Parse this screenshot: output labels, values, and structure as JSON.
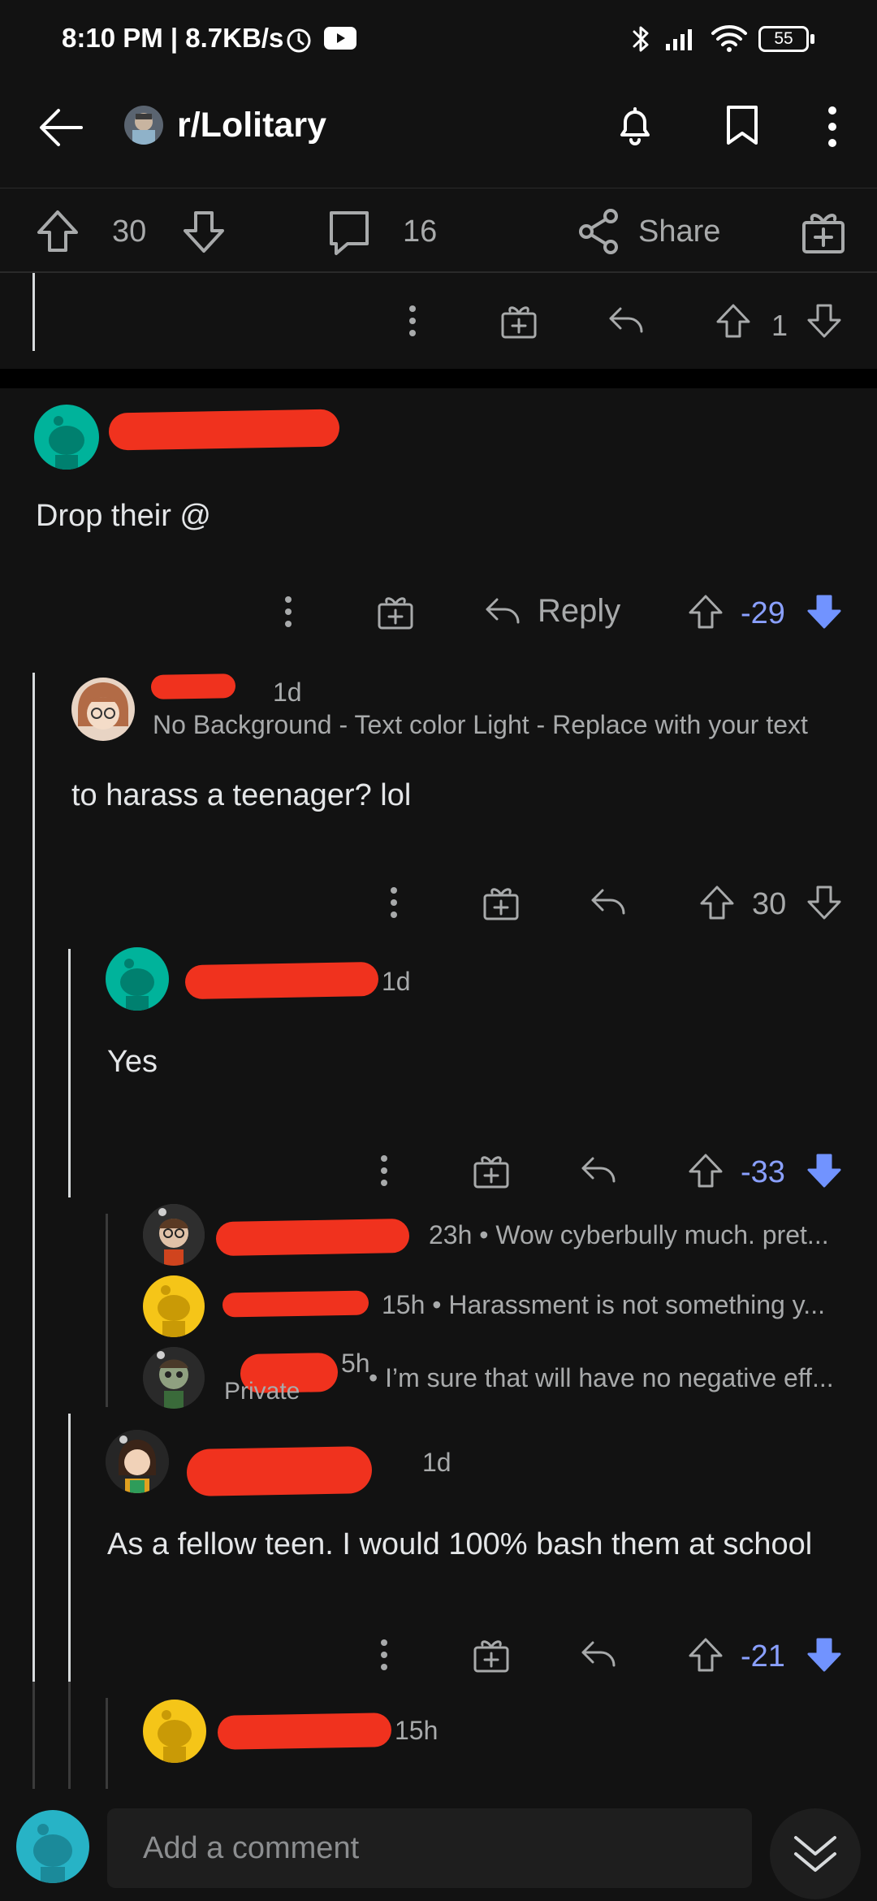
{
  "status_bar": {
    "time_speed": "8:10 PM | 8.7KB/s",
    "battery": "55"
  },
  "header": {
    "subreddit": "r/Lolitary"
  },
  "post_actions": {
    "score": "30",
    "comments": "16",
    "share_label": "Share"
  },
  "top_action_row": {
    "score": "1"
  },
  "comments": [
    {
      "author": "",
      "time": "",
      "body": "Drop their @",
      "reply_label": "Reply",
      "score": "-29"
    },
    {
      "author": "",
      "time": "1d",
      "flair": "No Background - Text color Light - Replace with your text",
      "body": "to harass a teenager? lol",
      "score": "30"
    },
    {
      "author": "",
      "time": "1d",
      "body": "Yes",
      "score": "-33"
    },
    {
      "author": "",
      "time": "1d",
      "body": "As a fellow teen. I would 100% bash them at school",
      "score": "-21"
    },
    {
      "author": "",
      "time": "15h"
    }
  ],
  "collapsed": [
    {
      "author": "",
      "preview": "23h • Wow cyberbully much. pret..."
    },
    {
      "author": "",
      "preview": "15h • Harassment is not something y..."
    },
    {
      "author": "",
      "time": "5h",
      "sub": "Private",
      "preview": "• I’m sure that will have no negative eff..."
    }
  ],
  "composer": {
    "placeholder": "Add a comment"
  }
}
